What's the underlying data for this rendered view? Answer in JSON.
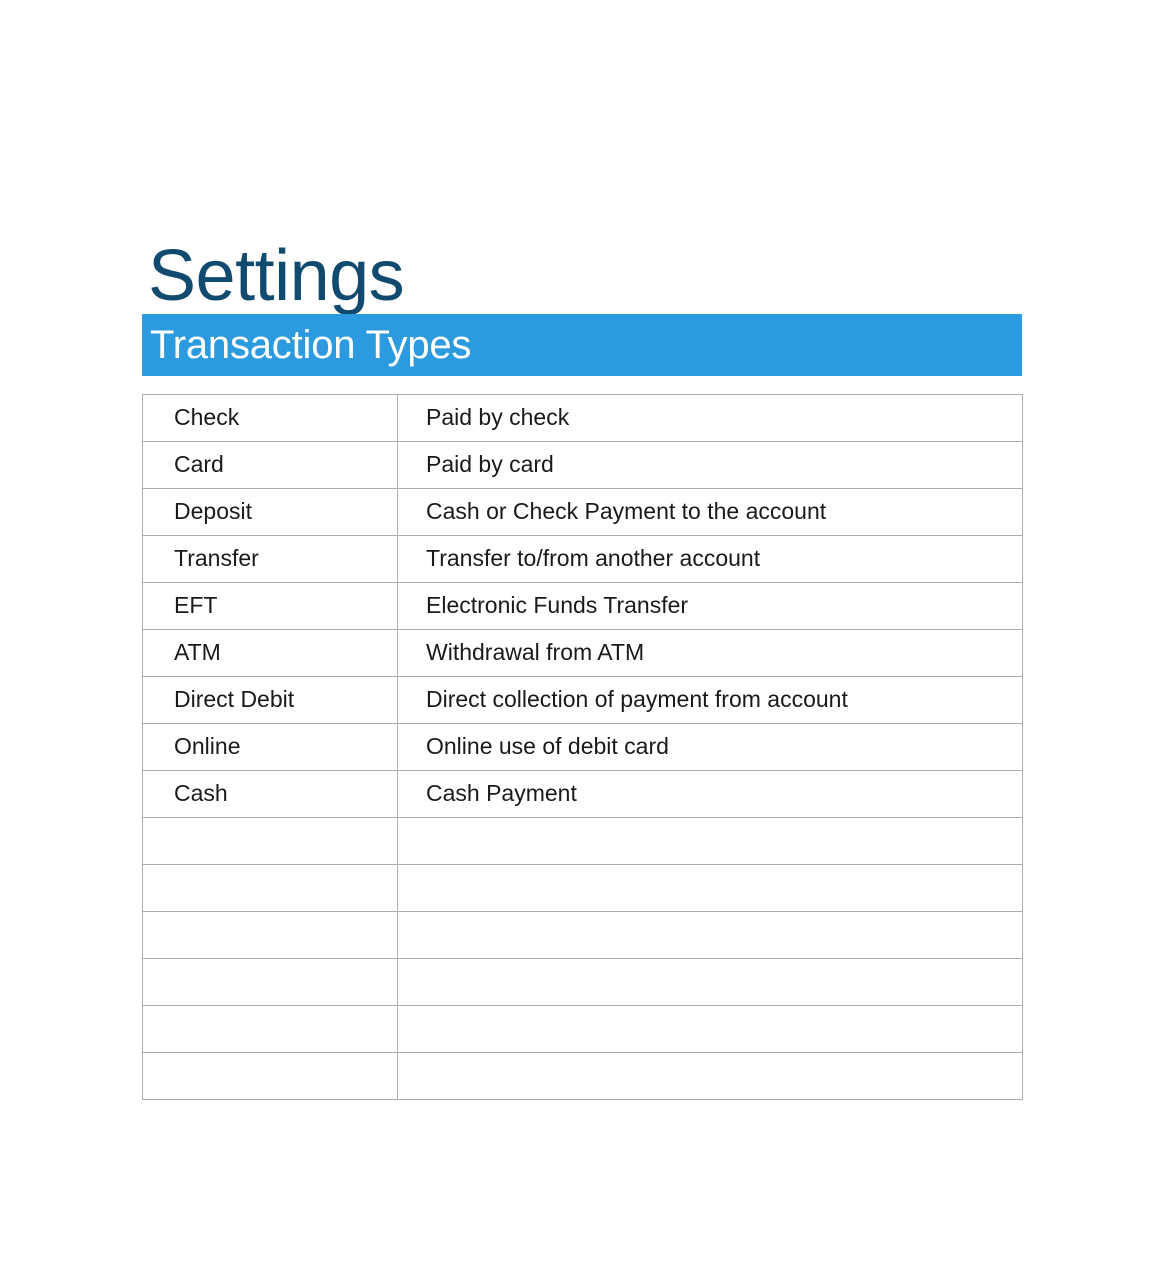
{
  "page": {
    "title": "Settings"
  },
  "section": {
    "banner_title": "Transaction Types",
    "banner_color": "#2b9ade",
    "banner_text_color": "#ffffff"
  },
  "colors": {
    "title_color": "#104a6e",
    "accent": "#2b9ade",
    "table_border": "#adadad",
    "cell_text": "#1a1a1a",
    "page_background": "#ffffff"
  },
  "table": {
    "column_count": 2,
    "row_count": 15,
    "filled_row_count": 9,
    "empty_row_count": 6,
    "rows": [
      {
        "type": "Check",
        "description": "Paid by check"
      },
      {
        "type": "Card",
        "description": "Paid by card"
      },
      {
        "type": "Deposit",
        "description": "Cash or Check Payment to the account"
      },
      {
        "type": "Transfer",
        "description": "Transfer to/from another account"
      },
      {
        "type": "EFT",
        "description": "Electronic Funds Transfer"
      },
      {
        "type": "ATM",
        "description": "Withdrawal from ATM"
      },
      {
        "type": "Direct Debit",
        "description": "Direct collection of payment from account"
      },
      {
        "type": "Online",
        "description": "Online use of debit card"
      },
      {
        "type": "Cash",
        "description": "Cash Payment"
      },
      {
        "type": "",
        "description": ""
      },
      {
        "type": "",
        "description": ""
      },
      {
        "type": "",
        "description": ""
      },
      {
        "type": "",
        "description": ""
      },
      {
        "type": "",
        "description": ""
      },
      {
        "type": "",
        "description": ""
      }
    ]
  }
}
